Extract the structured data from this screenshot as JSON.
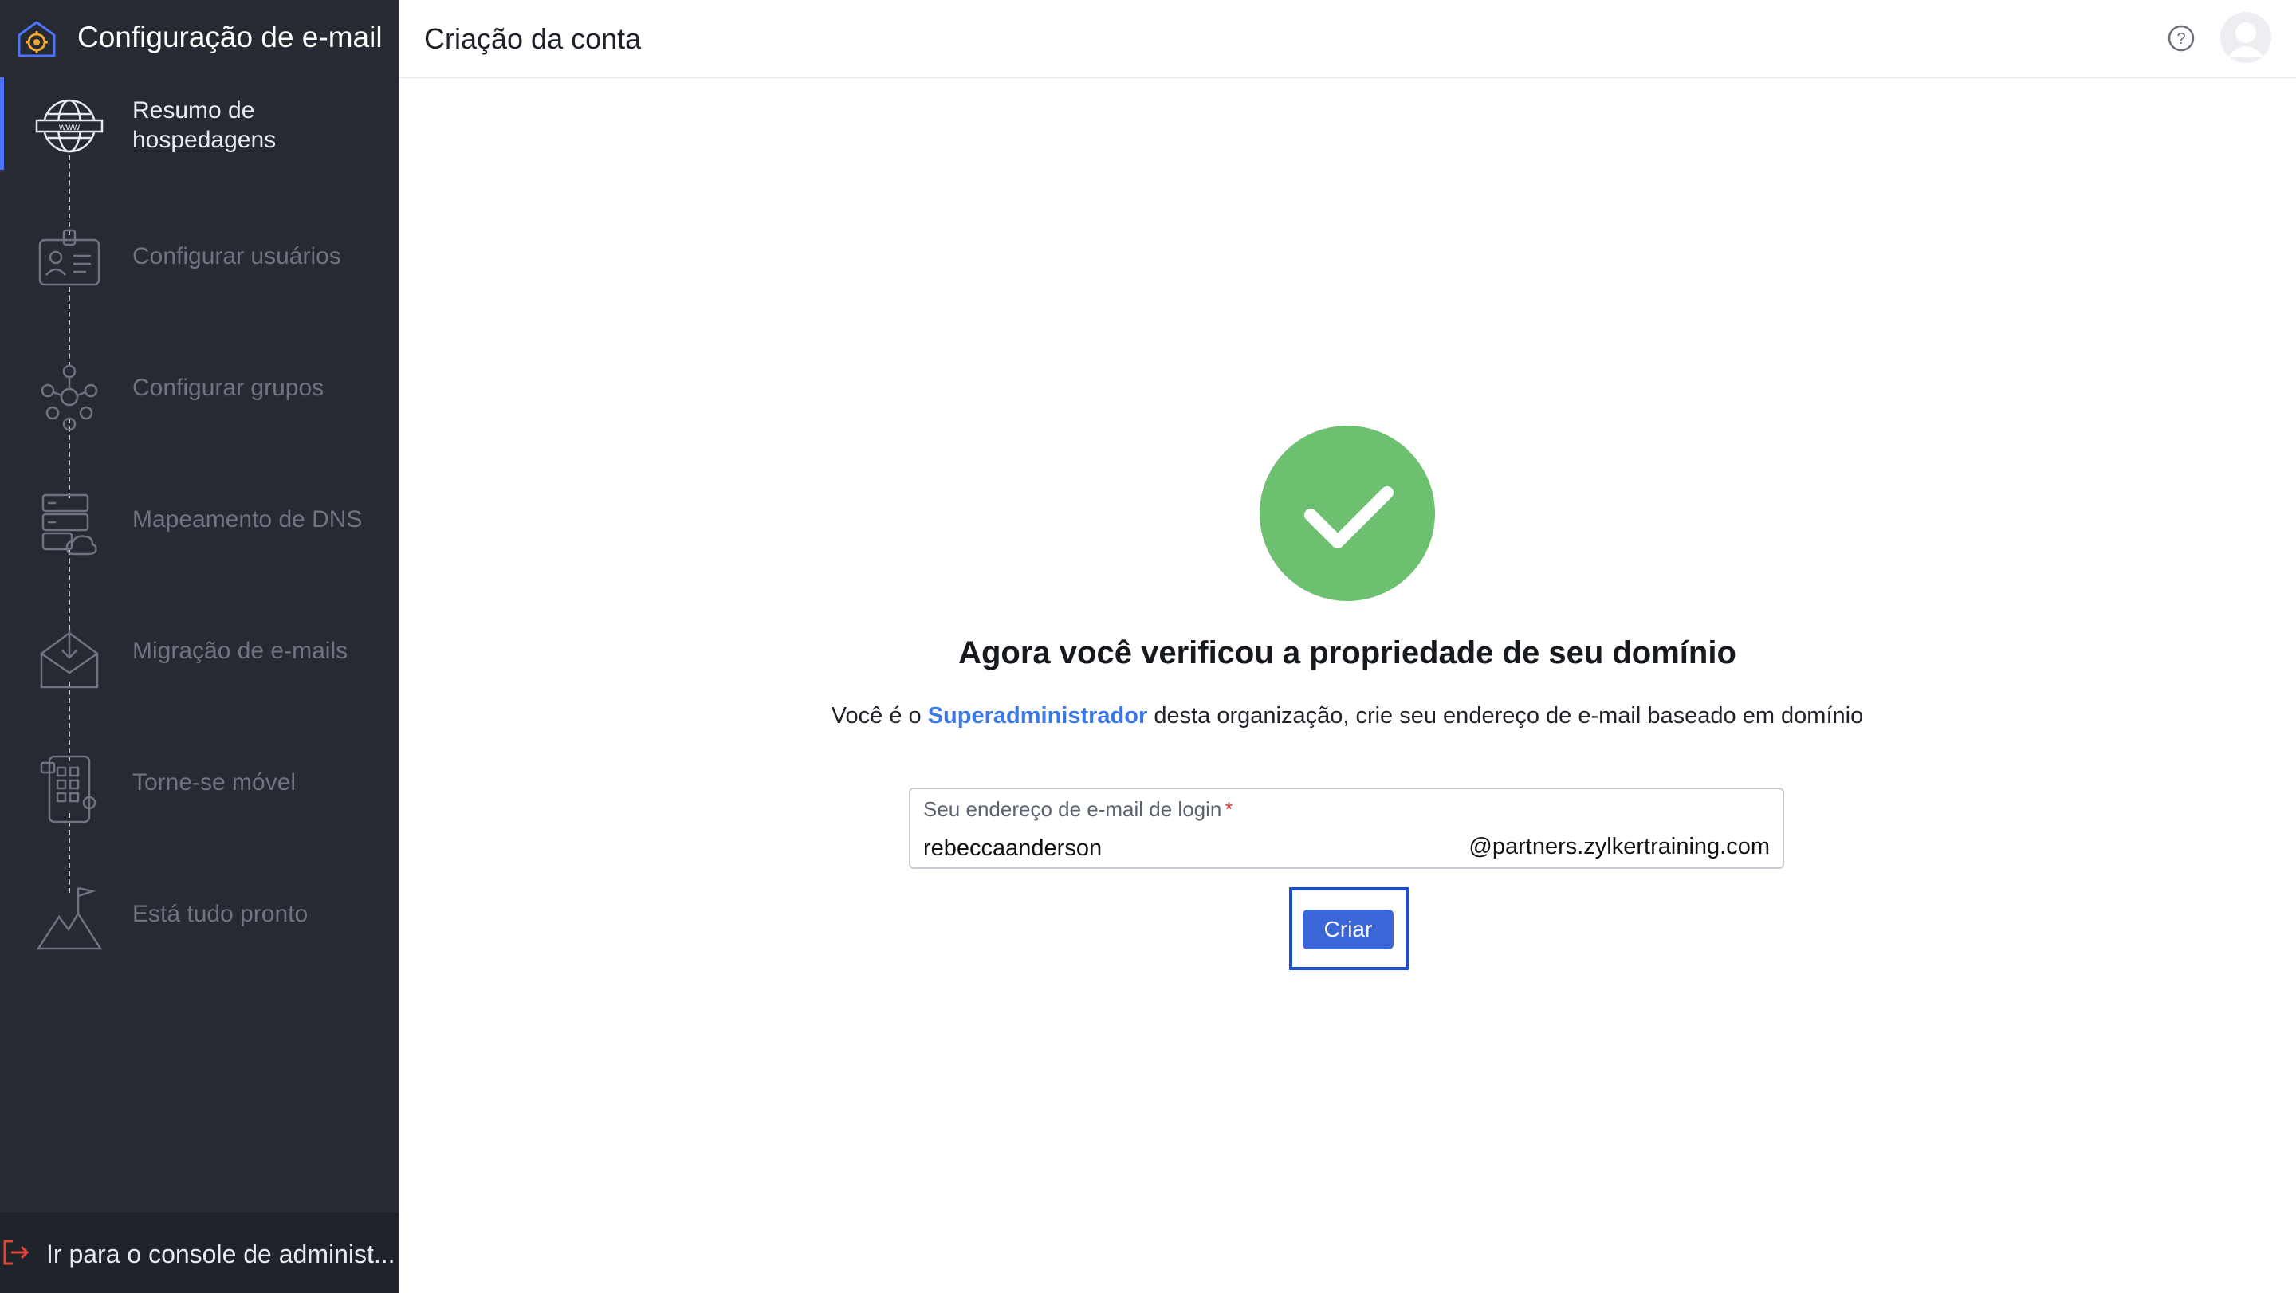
{
  "sidebar": {
    "title": "Configuração de e-mail",
    "steps": [
      {
        "label_line1": "Resumo de",
        "label_line2": "hospedagens",
        "icon": "globe-www-icon",
        "active": true
      },
      {
        "label": "Configurar usuários",
        "icon": "id-badge-icon"
      },
      {
        "label": "Configurar grupos",
        "icon": "group-network-icon"
      },
      {
        "label": "Mapeamento de DNS",
        "icon": "server-cloud-icon"
      },
      {
        "label": "Migração de e-mails",
        "icon": "envelope-download-icon"
      },
      {
        "label": "Torne-se móvel",
        "icon": "mobile-apps-icon"
      },
      {
        "label": "Está tudo pronto",
        "icon": "mountain-flag-icon"
      }
    ],
    "footer_label": "Ir para o console de administ..."
  },
  "header": {
    "title": "Criação da conta",
    "help_icon": "question-circle-icon",
    "avatar_icon": "user-avatar-icon"
  },
  "main": {
    "heading": "Agora você verificou a propriedade de seu domínio",
    "desc_prefix": "Você é o",
    "desc_link": "Superadministrador",
    "desc_suffix": "desta organização, crie seu endereço de e-mail baseado em domínio",
    "field_label": "Seu endereço de e-mail de login",
    "required_mark": "*",
    "field_value": "rebeccaanderson",
    "domain_suffix": "@partners.zylkertraining.com",
    "create_button": "Criar"
  },
  "colors": {
    "sidebar_bg": "#262a33",
    "accent": "#4b73ff",
    "success": "#6cc070",
    "button": "#3a66d8",
    "link": "#3b78e7"
  }
}
